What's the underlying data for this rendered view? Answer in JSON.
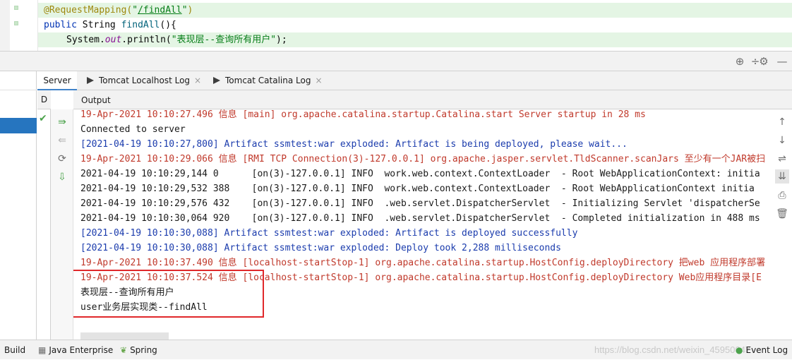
{
  "editor": {
    "line1": {
      "annotation": "@RequestMapping(",
      "path_quote_open": "\"",
      "path": "/findAll",
      "path_quote_close": "\"",
      "close": ")"
    },
    "line2": {
      "kw": "public",
      "type": " String ",
      "method": "findAll",
      "rest": "(){"
    },
    "line3": {
      "obj": "System.",
      "field": "out",
      "call": ".println(",
      "str": "\"表现层--查询所有用户\"",
      "end": ");"
    }
  },
  "toolbar_icons": [
    "crosshair-icon",
    "minus-icon",
    "gear-icon",
    "minimize-icon"
  ],
  "tabs": [
    {
      "label": "Server",
      "closable": false
    },
    {
      "label": "Tomcat Localhost Log",
      "closable": true,
      "close": "×"
    },
    {
      "label": "Tomcat Catalina Log",
      "closable": true,
      "close": "×"
    }
  ],
  "deploy_header": "D",
  "output_header": "Output",
  "console_lines": [
    {
      "text": "19-Apr-2021 10:10:27.496 信息 [main] org.apache.catalina.startup.Catalina.start Server startup in 28 ms",
      "color": "red"
    },
    {
      "text": "Connected to server",
      "color": "dark"
    },
    {
      "text": "[2021-04-19 10:10:27,800] Artifact ssmtest:war exploded: Artifact is being deployed, please wait...",
      "color": "blue"
    },
    {
      "text": "19-Apr-2021 10:10:29.066 信息 [RMI TCP Connection(3)-127.0.0.1] org.apache.jasper.servlet.TldScanner.scanJars 至少有一个JAR被扫",
      "color": "red"
    },
    {
      "text": "2021-04-19 10:10:29,144 0      [on(3)-127.0.0.1] INFO  work.web.context.ContextLoader  - Root WebApplicationContext: initia",
      "color": "dark"
    },
    {
      "text": "2021-04-19 10:10:29,532 388    [on(3)-127.0.0.1] INFO  work.web.context.ContextLoader  - Root WebApplicationContext initia",
      "color": "dark"
    },
    {
      "text": "2021-04-19 10:10:29,576 432    [on(3)-127.0.0.1] INFO  .web.servlet.DispatcherServlet  - Initializing Servlet 'dispatcherSe",
      "color": "dark"
    },
    {
      "text": "2021-04-19 10:10:30,064 920    [on(3)-127.0.0.1] INFO  .web.servlet.DispatcherServlet  - Completed initialization in 488 ms",
      "color": "dark"
    },
    {
      "text": "[2021-04-19 10:10:30,088] Artifact ssmtest:war exploded: Artifact is deployed successfully",
      "color": "blue"
    },
    {
      "text": "[2021-04-19 10:10:30,088] Artifact ssmtest:war exploded: Deploy took 2,288 milliseconds",
      "color": "blue"
    },
    {
      "text": "19-Apr-2021 10:10:37.490 信息 [localhost-startStop-1] org.apache.catalina.startup.HostConfig.deployDirectory 把web 应用程序部署",
      "color": "red"
    },
    {
      "text": "19-Apr-2021 10:10:37.524 信息 [localhost-startStop-1] org.apache.catalina.startup.HostConfig.deployDirectory Web应用程序目录[E",
      "color": "red"
    },
    {
      "text": "表现层--查询所有用户",
      "color": "dark"
    },
    {
      "text": "user业务层实现类--findAll",
      "color": "dark"
    }
  ],
  "status_bar": {
    "items": [
      {
        "label": "Build",
        "icon": ""
      },
      {
        "label": "Java Enterprise",
        "icon": "▦"
      },
      {
        "label": "Spring",
        "icon": "❦"
      },
      {
        "label": "Event Log",
        "icon": "●"
      }
    ],
    "watermark": "https://blog.csdn.net/weixin_45950047"
  },
  "colors": {
    "accent": "#2675bf",
    "highlight_box": "#e0282b",
    "info_red": "#c0392b",
    "artifact_blue": "#1b3cad"
  }
}
